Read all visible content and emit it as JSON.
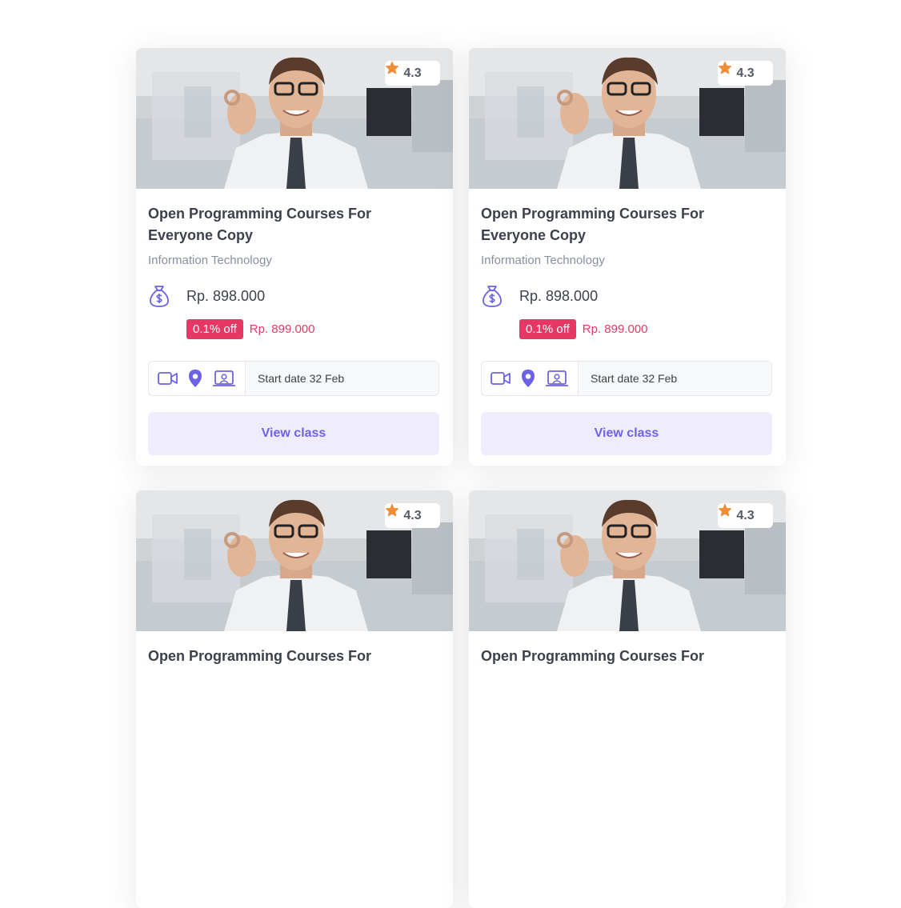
{
  "colors": {
    "accent": "#6d63e6",
    "accent_bg": "#efedfc",
    "discount": "#e53864",
    "star": "#f28c38",
    "title": "#3d414c",
    "muted": "#8a8fa0"
  },
  "cards": [
    {
      "rating": "4.3",
      "title": "Open Programming Courses For Everyone Copy",
      "category": "Information Technology",
      "price": "Rp. 898.000",
      "discount": "0.1% off",
      "old_price": "Rp. 899.000",
      "start_date": "Start date 32 Feb",
      "button_label": "View class",
      "icons": [
        "video-icon",
        "location-pin-icon",
        "classroom-icon"
      ]
    },
    {
      "rating": "4.3",
      "title": "Open Programming Courses For Everyone Copy",
      "category": "Information Technology",
      "price": "Rp. 898.000",
      "discount": "0.1% off",
      "old_price": "Rp. 899.000",
      "start_date": "Start date 32 Feb",
      "button_label": "View class",
      "icons": [
        "video-icon",
        "location-pin-icon",
        "classroom-icon"
      ]
    },
    {
      "rating": "4.3",
      "title": "Open Programming Courses For",
      "category": "",
      "price": "",
      "discount": "",
      "old_price": "",
      "start_date": "",
      "button_label": "",
      "icons": []
    },
    {
      "rating": "4.3",
      "title": "Open Programming Courses For",
      "category": "",
      "price": "",
      "discount": "",
      "old_price": "",
      "start_date": "",
      "button_label": "",
      "icons": []
    }
  ]
}
